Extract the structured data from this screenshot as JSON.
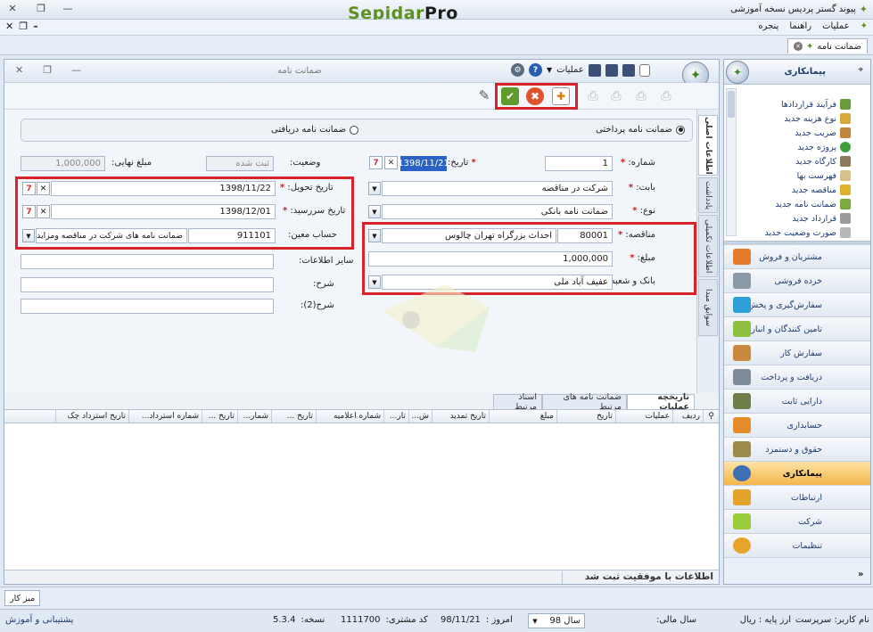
{
  "app": {
    "title": "پیوند گستر پردیس نسخه آموزشی",
    "brand_a": "Sepidar",
    "brand_b": "Pro"
  },
  "menu": {
    "operations": "عملیات",
    "help": "راهنما",
    "window": "پنجره"
  },
  "doc_tab": {
    "label": "ضمانت نامه"
  },
  "window": {
    "title": "ضمانت نامه",
    "operations": "عملیات"
  },
  "form": {
    "radio_paid": "ضمانت نامه پرداختی",
    "radio_received": "ضمانت نامه دریافتی",
    "number_label": "شماره:",
    "number_value": "1",
    "date_label": "تاریخ:",
    "date_value": "1398/11/21",
    "status_label": "وضعیت:",
    "status_value": "ثبت شده",
    "final_amount_label": "مبلغ نهایی:",
    "final_amount_value": "1,000,000",
    "babat_label": "بابت:",
    "babat_value": "شرکت در مناقصه",
    "type_label": "نوع:",
    "type_value": "ضمانت نامه بانکی",
    "tender_label": "مناقصه:",
    "tender_code": "80001",
    "tender_name": "احداث بزرگراه تهران چالوس",
    "amount_label": "مبلغ:",
    "amount_value": "1,000,000",
    "bank_label": "بانک و شعبه:",
    "bank_value": "عفیف آباد ملی",
    "delivery_label": "تاریخ تحویل:",
    "delivery_value": "1398/11/22",
    "due_label": "تاریخ سررسید:",
    "due_value": "1398/12/01",
    "account_label": "حساب معین:",
    "account_code": "911101",
    "account_name": "ضمانت نامه های شرکت در مناقصه ومزایده",
    "other_label": "سایر اطلاعات:",
    "desc_label": "شرح:",
    "desc2_label": "شرح(2):"
  },
  "vtabs": [
    "اطلاعات اصلی",
    "یادداشت",
    "اطلاعات تکمیلی",
    "سوابق مبدا"
  ],
  "bottom_tabs": [
    "تاریخچه عملیات",
    "ضمانت نامه های مرتبط",
    "اسناد مرتبط"
  ],
  "grid_columns": [
    "ردیف",
    "عملیات",
    "تاریخ",
    "مبلغ",
    "تاریخ تمدید",
    "ش...",
    "تار...",
    "شماره اعلامیه",
    "تاریخ ...",
    "شمار...",
    "تاریخ ...",
    "شماره استرداد...",
    "تاریخ استرداد چک"
  ],
  "status_msg": "اطلاعات با موفقیت ثبت شد",
  "sidebar": {
    "title": "پیمانکاری",
    "subitems": [
      "فرآیند قراردادها",
      "نوع هزینه جدید",
      "ضریب جدید",
      "پروژه جدید",
      "کارگاه جدید",
      "فهرست بها",
      "مناقصه جدید",
      "ضمانت نامه جدید",
      "قرارداد جدید",
      "صورت وضعیت جدید"
    ],
    "modules": [
      "مشتریان و فروش",
      "خرده فروشی",
      "سفارش‌گیری و پخش",
      "تامین کنندگان و انبار",
      "سفارش کار",
      "دریافت و پرداخت",
      "دارایی ثابت",
      "حسابداری",
      "حقوق و دستمزد",
      "پیمانکاری",
      "ارتباطات",
      "شرکت",
      "تنظیمات"
    ]
  },
  "mizkar": "میز کار",
  "statusbar": {
    "user": "نام کاربر: سرپرست",
    "currency": "ارز پایه : ریال",
    "fiscal_label": "سال مالی:",
    "fiscal_value": "سال 98",
    "today_label": "امروز :",
    "today_value": "98/11/21",
    "customer_label": "کد مشتری:",
    "customer_value": "1111700",
    "version_label": "نسخه:",
    "version_value": "5.3.4",
    "support": "پشتیبانی و آموزش"
  }
}
